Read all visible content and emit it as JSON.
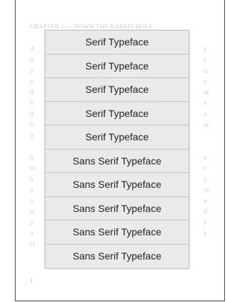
{
  "book": {
    "chapter_header": "CHAPTER 1 — DOWN THE RABBIT-HOLE",
    "page_number": "1",
    "left_edge_letters": [
      "A",
      "ti",
      "b",
      "o",
      "tl",
      "it",
      "ir",
      "b",
      "p",
      "",
      "S",
      "m",
      "h",
      "a",
      "o",
      "w",
      "p",
      "a",
      "cl"
    ],
    "right_edge_letters": [
      "y",
      "e",
      "o:",
      "o",
      "at",
      "s",
      "a",
      "at",
      "",
      "",
      "n",
      "e",
      "y",
      "re",
      "e",
      "d",
      "y",
      "n",
      ""
    ]
  },
  "typeface_menu": {
    "options": [
      "Serif Typeface",
      "Serif Typeface",
      "Serif Typeface",
      "Serif Typeface",
      "Serif Typeface",
      "Sans Serif Typeface",
      "Sans Serif Typeface",
      "Sans Serif Typeface",
      "Sans Serif Typeface",
      "Sans Serif Typeface"
    ]
  }
}
